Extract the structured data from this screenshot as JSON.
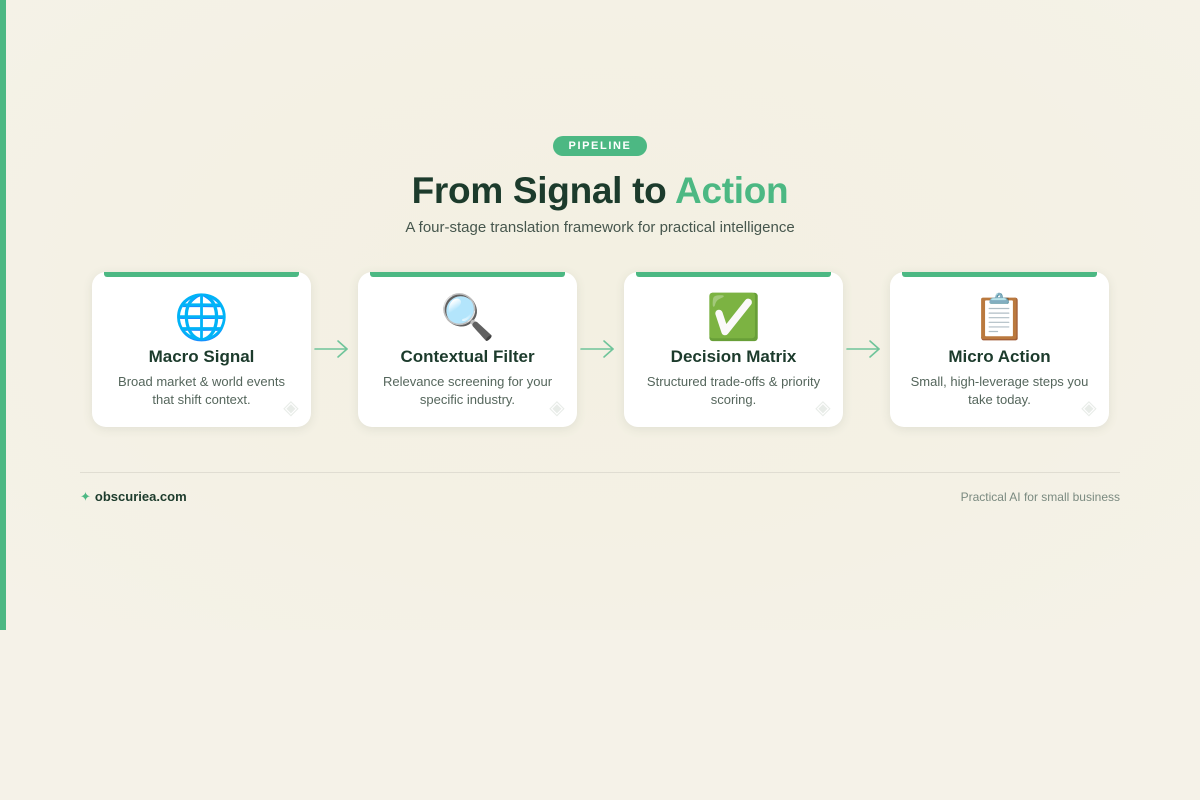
{
  "badge": "PIPELINE",
  "title": {
    "main": "From Signal to ",
    "highlight": "Action"
  },
  "subtitle": "A four-stage translation framework for practical intelligence",
  "stages": [
    {
      "icon": "🌐",
      "icon_name": "globe-icon",
      "name": "Macro Signal",
      "desc": "Broad market & world events that shift context."
    },
    {
      "icon": "🔍",
      "icon_name": "magnifier-icon",
      "name": "Contextual Filter",
      "desc": "Relevance screening for your specific industry."
    },
    {
      "icon": "✅",
      "icon_name": "checkmark-icon",
      "name": "Decision Matrix",
      "desc": "Structured trade-offs & priority scoring."
    },
    {
      "icon": "📋",
      "icon_name": "clipboard-icon",
      "name": "Micro Action",
      "desc": "Small, high-leverage steps you take today."
    }
  ],
  "footer": {
    "brand_mark": "✦",
    "brand": "obscuriea.com",
    "tagline": "Practical AI for small business"
  },
  "colors": {
    "accent": "#4cb883",
    "heading": "#1c3b2c",
    "background": "#f5f2e8"
  }
}
